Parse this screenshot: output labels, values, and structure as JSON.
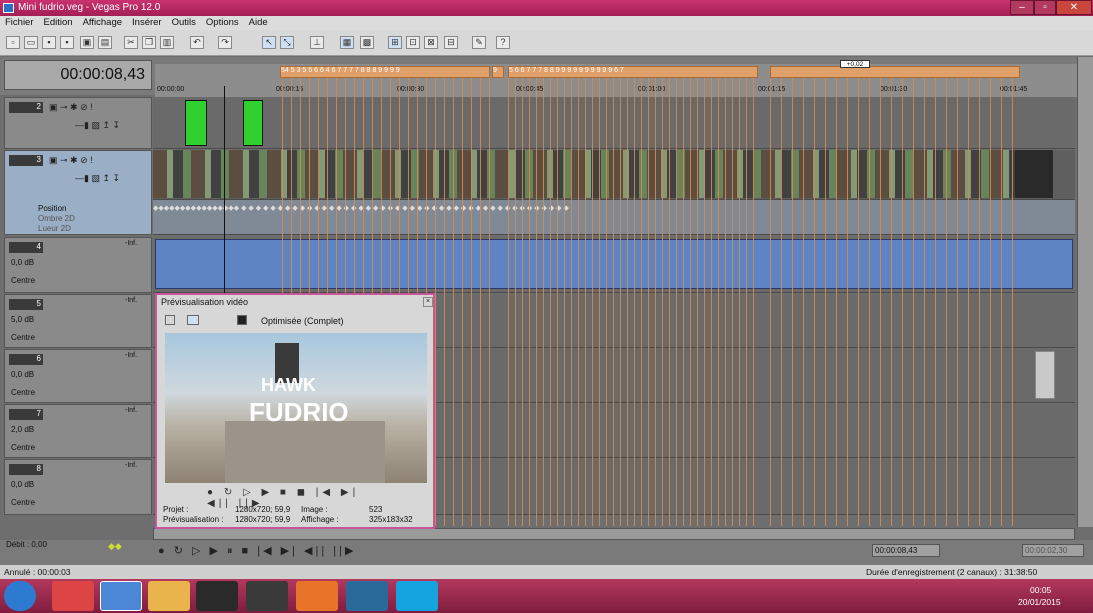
{
  "window": {
    "title": "Mini fudrio.veg - Vegas Pro 12.0"
  },
  "menu": {
    "items": [
      "Fichier",
      "Edition",
      "Affichage",
      "Insérer",
      "Outils",
      "Options",
      "Aide"
    ]
  },
  "timeline": {
    "cursor_time": "00:00:08,43",
    "ruler_ticks": [
      "00:00:00",
      "00:00:15",
      "00:00:30",
      "00:00:45",
      "00:01:00",
      "00:01:15",
      "00:01:30",
      "00:01:45"
    ],
    "marker_text": "+0,02",
    "video_tracks": [
      {
        "number": "2"
      },
      {
        "number": "3",
        "fx_labels": [
          "Position",
          "Ombre 2D",
          "Lueur 2D"
        ]
      }
    ],
    "audio_tracks": [
      {
        "number": "4",
        "volume": "0,0 dB",
        "pan": "Centre",
        "meter": "-Inf."
      },
      {
        "number": "5",
        "volume": "5,0 dB",
        "pan": "Centre",
        "meter": "-Inf."
      },
      {
        "number": "6",
        "volume": "0,0 dB",
        "pan": "Centre",
        "meter": "-Inf."
      },
      {
        "number": "7",
        "volume": "2,0 dB",
        "pan": "Centre",
        "meter": "-Inf."
      },
      {
        "number": "8",
        "volume": "0,0 dB",
        "pan": "Centre",
        "meter": "-Inf."
      }
    ]
  },
  "preview": {
    "title": "Prévisualisation vidéo",
    "quality": "Optimisée (Complet)",
    "overlay_line1": "HAWK",
    "overlay_line2": "FUDRIO",
    "info": {
      "project_label": "Projet :",
      "project_value": "1280x720; 59,9",
      "preview_label": "Prévisualisation :",
      "preview_value": "1280x720; 59,9",
      "image_label": "Image :",
      "image_value": "523",
      "display_label": "Affichage :",
      "display_value": "325x183x32"
    }
  },
  "transport": {
    "rate": "Débit : 0,00",
    "time_display": "00:00:08,43",
    "time_right": "00:00:02,30"
  },
  "status": {
    "left": "Annulé : 00:00:03",
    "right": "Durée d'enregistrement (2 canaux) : 31:38:50"
  },
  "taskbar": {
    "time": "00:05",
    "date": "20/01/2015"
  },
  "colors": {
    "title_bar": "#b5285f",
    "marker": "#e0a06a",
    "audio_clip": "#5f84c4",
    "video_green": "#2fd12f",
    "taskbar": "#9a2a4e"
  }
}
